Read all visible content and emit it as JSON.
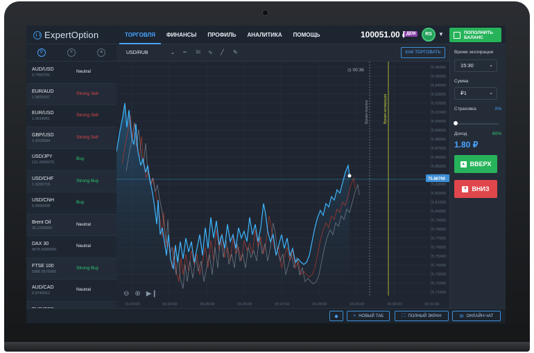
{
  "app": {
    "logo": "ExpertOption",
    "nav": [
      "ТОРГОВЛЯ",
      "ФИНАНСЫ",
      "ПРОФИЛЬ",
      "АНАЛИТИКА",
      "ПОМОЩЬ"
    ],
    "balance": "100051.00 ₽",
    "demo_badge": "ДЕМ",
    "avatar_initials": "RS",
    "deposit_label": "ПОПОЛНИТЬ БАЛАНС"
  },
  "sidebar": {
    "tab_icons": [
      "search-icon",
      "analytics-icon",
      "star-icon"
    ],
    "assets": [
      {
        "name": "AUD/USD",
        "price": "0.7050791",
        "signal": "Neutral"
      },
      {
        "name": "EUR/AUD",
        "price": "1.5833037",
        "signal": "Strong Sell"
      },
      {
        "name": "EUR/USD",
        "price": "1.0618961",
        "signal": "Strong Sell"
      },
      {
        "name": "GBP/USD",
        "price": "1.4209994",
        "signal": "Strong Sell"
      },
      {
        "name": "USD/JPY",
        "price": "121.0069375",
        "signal": "Buy"
      },
      {
        "name": "USD/CHF",
        "price": "1.0200719",
        "signal": "Strong Buy"
      },
      {
        "name": "USD/CNH",
        "price": "6.6990208",
        "signal": "Buy"
      },
      {
        "name": "Brent Oil",
        "price": "35.2250000",
        "signal": "Neutral"
      },
      {
        "name": "DAX 30",
        "price": "9675.5000000",
        "signal": "Neutral"
      },
      {
        "name": "FTSE 100",
        "price": "5986.9575000",
        "signal": "Strong Buy"
      },
      {
        "name": "AUD/CAD",
        "price": "0.9749312",
        "signal": "Neutral"
      },
      {
        "name": "EUR/GBP",
        "price": "",
        "signal": ""
      }
    ]
  },
  "chart_toolbar": {
    "pair": "USD/RUB",
    "timeframe": "1c",
    "how_to_trade": "КАК ТОРГОВАТЬ"
  },
  "chart": {
    "timer": "00:36",
    "purchase_time_label": "Время покупки",
    "expiry_time_label": "Время экспирации",
    "current_price": "75.86790",
    "price_ticks": [
      "75.96000",
      "75.95000",
      "75.94000",
      "75.93000",
      "75.92000",
      "75.91000",
      "75.90000",
      "75.89000",
      "75.88000",
      "75.87000",
      "75.86000",
      "75.85000",
      "75.84000",
      "75.83000",
      "75.82000",
      "75.81000",
      "75.80000",
      "75.79000",
      "75.78000",
      "75.77000",
      "75.76000",
      "75.75000",
      "75.74000",
      "75.73000",
      "75.72000",
      "75.71000"
    ],
    "time_ticks": [
      "15:23:00",
      "15:24:00",
      "15:25:00",
      "15:26:00",
      "15:27:00",
      "15:28:00",
      "15:29:00",
      "15:30:00",
      "15:31:00"
    ]
  },
  "right_panel": {
    "expiry_label": "Время экспирации",
    "expiry_value": "15:30",
    "amount_label": "Сумма",
    "amount_value": "₽1",
    "insurance_label": "Страховка",
    "insurance_pct": "0%",
    "income_label": "Доход",
    "income_pct": "80%",
    "income_value": "1.80 ₽",
    "up_label": "ВВЕРХ",
    "down_label": "ВНИЗ"
  },
  "bottombar": {
    "new_tab": "НОВЫЙ ТАБ",
    "fullscreen": "ПОЛНЫЙ ЭКРАН",
    "online_chat": "ОНЛАЙН-ЧАТ"
  },
  "colors": {
    "accent": "#4aa3ff",
    "buy": "#2ecc71",
    "sell": "#e0474c",
    "neutral": "#e6ebf1",
    "chart_line": "#3fb6ff",
    "expiry_line": "#c9d13a"
  }
}
